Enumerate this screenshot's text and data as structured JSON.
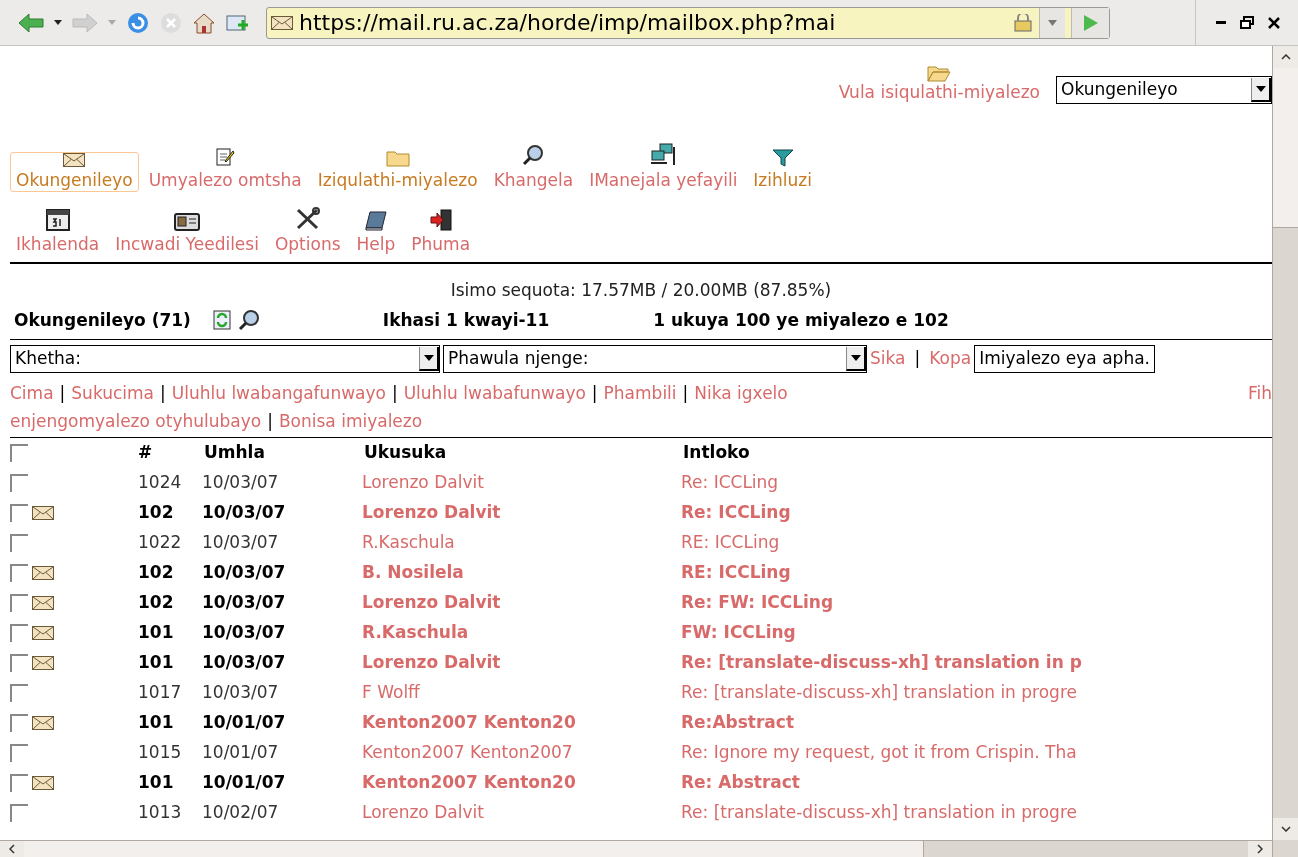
{
  "browser": {
    "url": "https://mail.ru.ac.za/horde/imp/mailbox.php?mai"
  },
  "folder_bar": {
    "open_link": "Vula isiqulathi-miyalezo",
    "folder_select": "Okungenileyo"
  },
  "menu_rows": [
    [
      {
        "label": "Okungenileyo",
        "kind": "mail",
        "selected": true,
        "visited": true
      },
      {
        "label": "Umyalezo omtsha",
        "kind": "compose",
        "selected": false,
        "visited": false
      },
      {
        "label": "Iziqulathi-miyalezo",
        "kind": "folder",
        "selected": false,
        "visited": true
      },
      {
        "label": "Khangela",
        "kind": "search",
        "selected": false,
        "visited": false
      },
      {
        "label": "IManejala yefayili",
        "kind": "computer",
        "selected": false,
        "visited": false
      },
      {
        "label": "Izihluzi",
        "kind": "filter",
        "selected": false,
        "visited": true
      }
    ],
    [
      {
        "label": "Ikhalenda",
        "kind": "calendar",
        "selected": false,
        "visited": false
      },
      {
        "label": "Incwadi Yeedilesi",
        "kind": "card",
        "selected": false,
        "visited": false
      },
      {
        "label": "Options",
        "kind": "tools",
        "selected": false,
        "visited": false
      },
      {
        "label": "Help",
        "kind": "book",
        "selected": false,
        "visited": false
      },
      {
        "label": "Phuma",
        "kind": "exit",
        "selected": false,
        "visited": false
      }
    ]
  ],
  "quota": "Isimo sequota: 17.57MB / 20.00MB (87.85%)",
  "mailbox_header": {
    "title": "Okungenileyo (71)",
    "page": "Ikhasi 1 kwayi-11",
    "range": "1 ukuya 100 ye miyalezo e 102"
  },
  "actions": {
    "select": "Khetha:",
    "mark": "Phawula njenge:",
    "move": "Sika",
    "separator": "|",
    "copy": "Kopa",
    "target": "Imiyalezo eya apha."
  },
  "nav_lines": [
    [
      {
        "kind": "link",
        "text": "Cima"
      },
      {
        "kind": "separator",
        "text": "|"
      },
      {
        "kind": "link",
        "text": "Sukucima"
      },
      {
        "kind": "separator",
        "text": "|"
      },
      {
        "kind": "link",
        "text": "Uluhlu lwabangafunwayo"
      },
      {
        "kind": "separator",
        "text": "|"
      },
      {
        "kind": "link",
        "text": "Uluhlu lwabafunwayo"
      },
      {
        "kind": "separator",
        "text": "|"
      },
      {
        "kind": "link",
        "text": "Phambili"
      },
      {
        "kind": "separator",
        "text": "|"
      },
      {
        "kind": "link",
        "text": "Nika igxelo"
      },
      {
        "kind": "right_link",
        "text": "Fih"
      }
    ],
    [
      {
        "kind": "link",
        "text": "enjengomyalezo otyhulubayo"
      },
      {
        "kind": "separator",
        "text": "|"
      },
      {
        "kind": "link",
        "text": "Bonisa imiyalezo"
      }
    ]
  ],
  "table": {
    "select_all_checked": false,
    "columns": [
      "#",
      "Umhla",
      "Ukusuka",
      "Intloko"
    ],
    "rows": [
      {
        "number": "1024",
        "date": "10/03/07",
        "from": "Lorenzo Dalvit",
        "subject": "Re: ICCLing",
        "unread": false,
        "checked": false
      },
      {
        "number": "102",
        "date": "10/03/07",
        "from": "Lorenzo Dalvit",
        "subject": "Re: ICCLing",
        "unread": true,
        "checked": false
      },
      {
        "number": "1022",
        "date": "10/03/07",
        "from": "R.Kaschula",
        "subject": "RE: ICCLing",
        "unread": false,
        "checked": false
      },
      {
        "number": "102",
        "date": "10/03/07",
        "from": "B. Nosilela",
        "subject": "RE: ICCLing",
        "unread": true,
        "checked": false
      },
      {
        "number": "102",
        "date": "10/03/07",
        "from": "Lorenzo Dalvit",
        "subject": "Re: FW: ICCLing",
        "unread": true,
        "checked": false
      },
      {
        "number": "101",
        "date": "10/03/07",
        "from": "R.Kaschula",
        "subject": "FW: ICCLing",
        "unread": true,
        "checked": false
      },
      {
        "number": "101",
        "date": "10/03/07",
        "from": "Lorenzo Dalvit",
        "subject": "Re: [translate-discuss-xh] translation in p",
        "unread": true,
        "checked": false
      },
      {
        "number": "1017",
        "date": "10/03/07",
        "from": "F Wolff",
        "subject": "Re: [translate-discuss-xh] translation in progre",
        "unread": false,
        "checked": false
      },
      {
        "number": "101",
        "date": "10/01/07",
        "from": "Kenton2007 Kenton20",
        "subject": "Re:Abstract",
        "unread": true,
        "checked": false
      },
      {
        "number": "1015",
        "date": "10/01/07",
        "from": "Kenton2007 Kenton2007",
        "subject": "Re: Ignore my request, got it from Crispin. Tha",
        "unread": false,
        "checked": false
      },
      {
        "number": "101",
        "date": "10/01/07",
        "from": "Kenton2007 Kenton20",
        "subject": "Re: Abstract",
        "unread": true,
        "checked": false
      },
      {
        "number": "1013",
        "date": "10/02/07",
        "from": "Lorenzo Dalvit",
        "subject": "Re: [translate-discuss-xh] translation in progre",
        "unread": false,
        "checked": false
      }
    ]
  }
}
